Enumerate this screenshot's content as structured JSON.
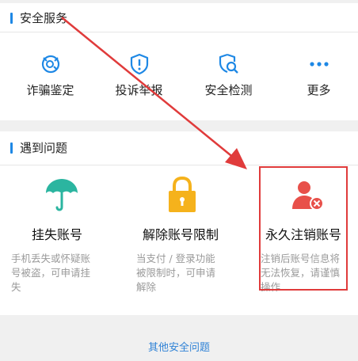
{
  "security_services": {
    "title": "安全服务",
    "items": [
      {
        "label": "诈骗鉴定",
        "icon": "fraud-check-icon"
      },
      {
        "label": "投诉举报",
        "icon": "report-shield-icon"
      },
      {
        "label": "安全检测",
        "icon": "security-scan-icon"
      },
      {
        "label": "更多",
        "icon": "more-dots-icon"
      }
    ]
  },
  "problems": {
    "title": "遇到问题",
    "items": [
      {
        "title": "挂失账号",
        "desc_lines": [
          "手机丢失或怀疑账",
          "号被盗，可申请挂",
          "失"
        ],
        "icon": "umbrella-icon"
      },
      {
        "title": "解除账号限制",
        "desc_lines": [
          "当支付 / 登录功能",
          "被限制时，可申请",
          "解除"
        ],
        "icon": "lock-icon"
      },
      {
        "title": "永久注销账号",
        "desc_lines": [
          "注销后账号信息将",
          "无法恢复，请谨慎",
          "操作"
        ],
        "icon": "delete-account-icon"
      }
    ]
  },
  "footer": {
    "link": "其他安全问题"
  },
  "colors": {
    "accent": "#1e88e5",
    "annotation_red": "#e03b3b",
    "umbrella": "#2bb5a0",
    "lock": "#f5b21c",
    "account_red": "#e8504a"
  }
}
